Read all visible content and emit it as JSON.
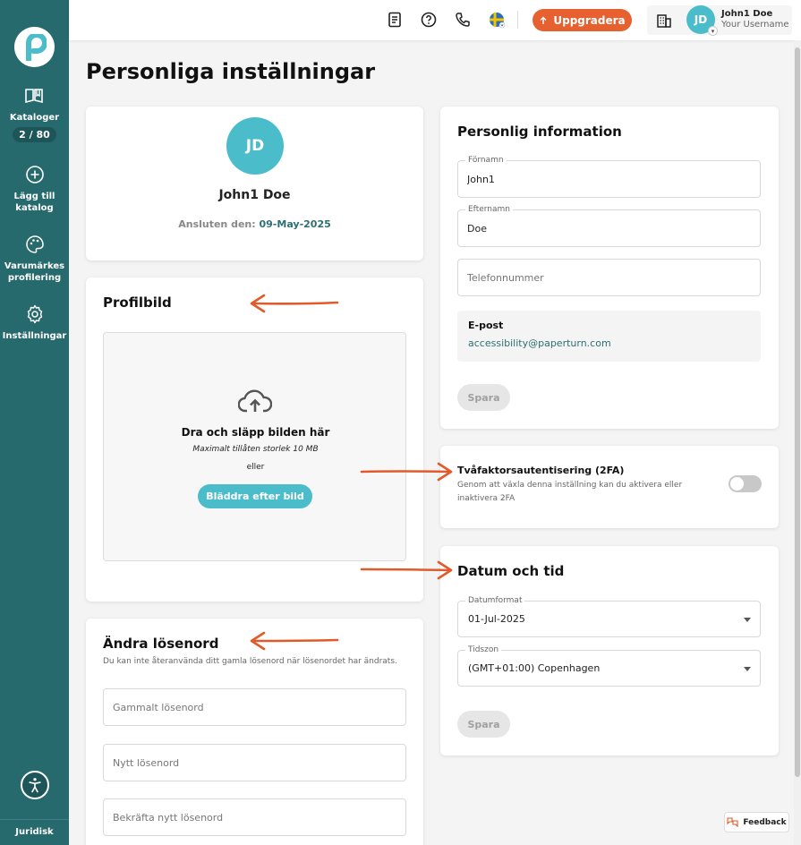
{
  "sidebar": {
    "items": [
      {
        "label": "Kataloger",
        "icon": "book-open-icon"
      },
      {
        "label": "Lägg till katalog",
        "icon": "plus-circle-icon"
      },
      {
        "label": "Varumärkes profilering",
        "icon": "palette-icon"
      },
      {
        "label": "Inställningar",
        "icon": "gear-icon"
      }
    ],
    "catalog_count": "2 / 80",
    "legal_label": "Juridisk"
  },
  "header": {
    "upgrade_label": "Uppgradera",
    "user_initials": "JD",
    "user_name": "John1 Doe",
    "user_sub": "Your Username"
  },
  "page": {
    "title": "Personliga inställningar"
  },
  "profile": {
    "initials": "JD",
    "name": "John1 Doe",
    "joined_label": "Ansluten den:",
    "joined_date": "09-May-2025"
  },
  "profile_picture": {
    "title": "Profilbild",
    "drop_title": "Dra och släpp bilden här",
    "max_size": "Maximalt tillåten storlek 10 MB",
    "or": "eller",
    "browse_label": "Bläddra efter bild"
  },
  "change_password": {
    "title": "Ändra lösenord",
    "help": "Du kan inte återanvända ditt gamla lösenord när lösenordet har ändrats.",
    "old_placeholder": "Gammalt lösenord",
    "new_placeholder": "Nytt lösenord",
    "confirm_placeholder": "Bekräfta nytt lösenord"
  },
  "personal_info": {
    "title": "Personlig information",
    "first_name_label": "Förnamn",
    "first_name_value": "John1",
    "last_name_label": "Efternamn",
    "last_name_value": "Doe",
    "phone_placeholder": "Telefonnummer",
    "email_label": "E-post",
    "email_value": "accessibility@paperturn.com",
    "save_label": "Spara"
  },
  "two_factor": {
    "title": "Tvåfaktorsautentisering (2FA)",
    "description": "Genom att växla denna inställning kan du aktivera eller inaktivera 2FA",
    "enabled": false
  },
  "date_time": {
    "title": "Datum och tid",
    "format_label": "Datumformat",
    "format_value": "01-Jul-2025",
    "timezone_label": "Tidszon",
    "timezone_value": "(GMT+01:00) Copenhagen",
    "save_label": "Spara"
  },
  "feedback_label": "Feedback",
  "colors": {
    "sidebar": "#266a6e",
    "accent": "#4bbcca",
    "upgrade": "#e6612f",
    "annotation_arrow": "#e05a2b"
  }
}
